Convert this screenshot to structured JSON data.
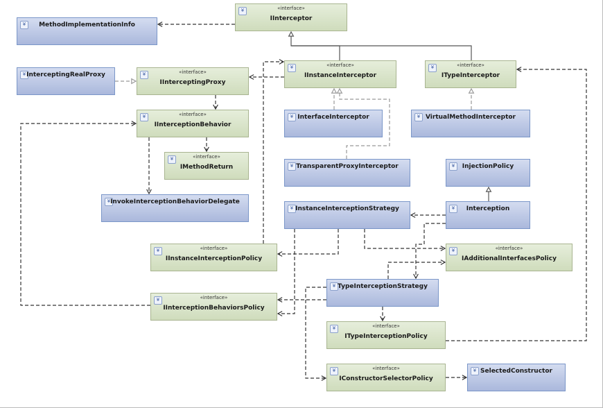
{
  "stereotype": "«interface»",
  "colors": {
    "class_fill": "#b8c6e6",
    "interface_fill": "#dbe6cc",
    "edge": "#333333",
    "realization_edge": "#999999"
  },
  "boxes": [
    {
      "id": "IInterceptor",
      "name": "IInterceptor",
      "kind": "interface"
    },
    {
      "id": "MethodImplementationInfo",
      "name": "MethodImplementationInfo",
      "kind": "class"
    },
    {
      "id": "InterceptingRealProxy",
      "name": "InterceptingRealProxy",
      "kind": "class"
    },
    {
      "id": "IInterceptingProxy",
      "name": "IInterceptingProxy",
      "kind": "interface"
    },
    {
      "id": "IInstanceInterceptor",
      "name": "IInstanceInterceptor",
      "kind": "interface"
    },
    {
      "id": "ITypeInterceptor",
      "name": "ITypeInterceptor",
      "kind": "interface"
    },
    {
      "id": "IInterceptionBehavior",
      "name": "IInterceptionBehavior",
      "kind": "interface"
    },
    {
      "id": "InterfaceInterceptor",
      "name": "InterfaceInterceptor",
      "kind": "class"
    },
    {
      "id": "VirtualMethodInterceptor",
      "name": "VirtualMethodInterceptor",
      "kind": "class"
    },
    {
      "id": "IMethodReturn",
      "name": "IMethodReturn",
      "kind": "interface"
    },
    {
      "id": "TransparentProxyInterceptor",
      "name": "TransparentProxyInterceptor",
      "kind": "class"
    },
    {
      "id": "InjectionPolicy",
      "name": "InjectionPolicy",
      "kind": "class"
    },
    {
      "id": "InvokeInterceptionBehaviorDelegate",
      "name": "InvokeInterceptionBehaviorDelegate",
      "kind": "class"
    },
    {
      "id": "InstanceInterceptionStrategy",
      "name": "InstanceInterceptionStrategy",
      "kind": "class"
    },
    {
      "id": "Interception",
      "name": "Interception",
      "kind": "class"
    },
    {
      "id": "IInstanceInterceptionPolicy",
      "name": "IInstanceInterceptionPolicy",
      "kind": "interface"
    },
    {
      "id": "IAdditionalInterfacesPolicy",
      "name": "IAdditionalInterfacesPolicy",
      "kind": "interface"
    },
    {
      "id": "TypeInterceptionStrategy",
      "name": "TypeInterceptionStrategy",
      "kind": "class"
    },
    {
      "id": "IInterceptionBehaviorsPolicy",
      "name": "IInterceptionBehaviorsPolicy",
      "kind": "interface"
    },
    {
      "id": "ITypeInterceptionPolicy",
      "name": "ITypeInterceptionPolicy",
      "kind": "interface"
    },
    {
      "id": "IConstructorSelectorPolicy",
      "name": "IConstructorSelectorPolicy",
      "kind": "interface"
    },
    {
      "id": "SelectedConstructor",
      "name": "SelectedConstructor",
      "kind": "class"
    }
  ],
  "edges": [
    {
      "from": "IInterceptor",
      "to": "MethodImplementationInfo",
      "type": "dependency"
    },
    {
      "from": "IInstanceInterceptor",
      "to": "IInterceptor",
      "type": "inheritance"
    },
    {
      "from": "ITypeInterceptor",
      "to": "IInterceptor",
      "type": "inheritance"
    },
    {
      "from": "InterceptingRealProxy",
      "to": "IInterceptingProxy",
      "type": "realization"
    },
    {
      "from": "IInstanceInterceptor",
      "to": "IInterceptingProxy",
      "type": "dependency"
    },
    {
      "from": "IInterceptingProxy",
      "to": "IInterceptionBehavior",
      "type": "dependency"
    },
    {
      "from": "IInterceptionBehavior",
      "to": "IMethodReturn",
      "type": "dependency"
    },
    {
      "from": "IInterceptionBehavior",
      "to": "InvokeInterceptionBehaviorDelegate",
      "type": "dependency"
    },
    {
      "from": "IInterceptionBehaviorsPolicy",
      "to": "IInterceptionBehavior",
      "type": "dependency"
    },
    {
      "from": "IInstanceInterceptionPolicy",
      "to": "IInstanceInterceptor",
      "type": "dependency"
    },
    {
      "from": "InterfaceInterceptor",
      "to": "IInstanceInterceptor",
      "type": "realization"
    },
    {
      "from": "TransparentProxyInterceptor",
      "to": "IInstanceInterceptor",
      "type": "realization"
    },
    {
      "from": "VirtualMethodInterceptor",
      "to": "ITypeInterceptor",
      "type": "realization"
    },
    {
      "from": "ITypeInterceptionPolicy",
      "to": "ITypeInterceptor",
      "type": "dependency"
    },
    {
      "from": "Interception",
      "to": "InjectionPolicy",
      "type": "inheritance"
    },
    {
      "from": "Interception",
      "to": "InstanceInterceptionStrategy",
      "type": "dependency"
    },
    {
      "from": "Interception",
      "to": "TypeInterceptionStrategy",
      "type": "dependency"
    },
    {
      "from": "InstanceInterceptionStrategy",
      "to": "IAdditionalInterfacesPolicy",
      "type": "dependency"
    },
    {
      "from": "TypeInterceptionStrategy",
      "to": "IAdditionalInterfacesPolicy",
      "type": "dependency"
    },
    {
      "from": "InstanceInterceptionStrategy",
      "to": "IInstanceInterceptionPolicy",
      "type": "dependency"
    },
    {
      "from": "InstanceInterceptionStrategy",
      "to": "IInterceptionBehaviorsPolicy",
      "type": "dependency"
    },
    {
      "from": "TypeInterceptionStrategy",
      "to": "IInterceptionBehaviorsPolicy",
      "type": "dependency"
    },
    {
      "from": "TypeInterceptionStrategy",
      "to": "IConstructorSelectorPolicy",
      "type": "dependency"
    },
    {
      "from": "TypeInterceptionStrategy",
      "to": "ITypeInterceptionPolicy",
      "type": "dependency"
    },
    {
      "from": "IConstructorSelectorPolicy",
      "to": "SelectedConstructor",
      "type": "dependency"
    }
  ]
}
